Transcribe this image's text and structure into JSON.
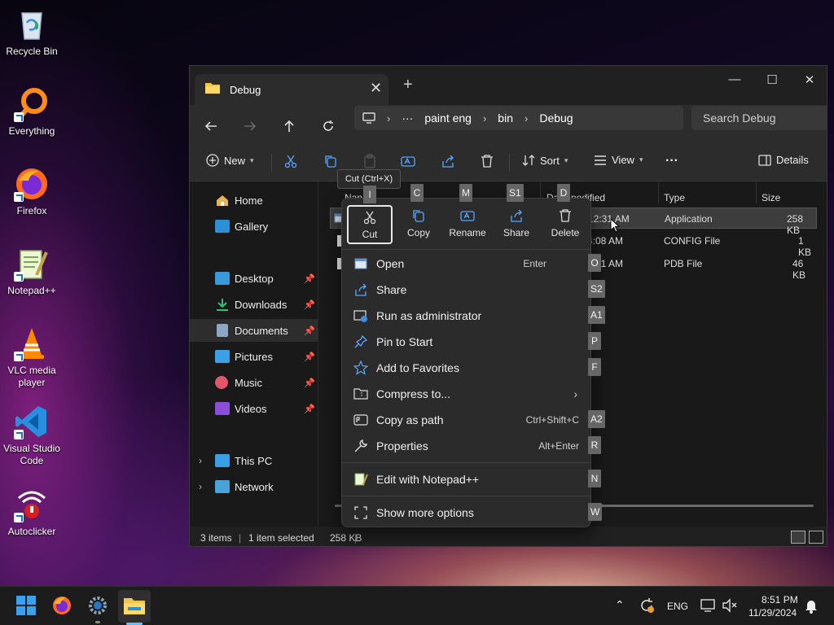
{
  "desktop_icons": [
    {
      "label": "Recycle Bin",
      "icon": "recycle-bin-icon"
    },
    {
      "label": "Everything",
      "icon": "everything-icon"
    },
    {
      "label": "Firefox",
      "icon": "firefox-icon"
    },
    {
      "label": "Notepad++",
      "icon": "notepad-plus-plus-icon"
    },
    {
      "label": "VLC media player",
      "icon": "vlc-icon"
    },
    {
      "label": "Visual Studio Code",
      "icon": "vscode-icon"
    },
    {
      "label": "Autoclicker",
      "icon": "autoclicker-icon"
    }
  ],
  "window": {
    "tab_title": "Debug",
    "tab_close": "✕",
    "new_tab": "+",
    "minimize": "—",
    "maximize": "☐",
    "close": "✕"
  },
  "address": {
    "more": "···",
    "crumbs": [
      "paint eng",
      "bin",
      "Debug"
    ],
    "search_placeholder": "Search Debug"
  },
  "toolbar": {
    "new_label": "New",
    "sort_label": "Sort",
    "view_label": "View",
    "more_label": "···",
    "details_label": "Details"
  },
  "sidebar": {
    "home": "Home",
    "gallery": "Gallery",
    "desktop": "Desktop",
    "downloads": "Downloads",
    "documents": "Documents",
    "pictures": "Pictures",
    "music": "Music",
    "videos": "Videos",
    "this_pc": "This PC",
    "network": "Network"
  },
  "columns": {
    "name": "Nan",
    "date": "Da",
    "date_tail": "nodified",
    "type": "Type",
    "size": "Size"
  },
  "rows": [
    {
      "date": "12:31 AM",
      "type": "Application",
      "size": "258 KB"
    },
    {
      "date": "4:08 AM",
      "type": "CONFIG File",
      "size": "1 KB"
    },
    {
      "date": "2:31 AM",
      "type": "PDB File",
      "size": "46 KB"
    }
  ],
  "status": {
    "items": "3 items",
    "selected": "1 item selected",
    "size": "258 KB",
    "divider": "|"
  },
  "tooltip": "Cut (Ctrl+X)",
  "context_menu": {
    "top_actions": {
      "cut": "Cut",
      "copy": "Copy",
      "rename": "Rename",
      "share": "Share",
      "delete": "Delete"
    },
    "items": {
      "open": {
        "label": "Open",
        "shortcut": "Enter"
      },
      "share": {
        "label": "Share"
      },
      "run_admin": {
        "label": "Run as administrator"
      },
      "pin_start": {
        "label": "Pin to Start"
      },
      "favorites": {
        "label": "Add to Favorites"
      },
      "compress": {
        "label": "Compress to...",
        "arrow": "›"
      },
      "copy_path": {
        "label": "Copy as path",
        "shortcut": "Ctrl+Shift+C"
      },
      "properties": {
        "label": "Properties",
        "shortcut": "Alt+Enter"
      },
      "notepad": {
        "label": "Edit with Notepad++"
      },
      "more_options": {
        "label": "Show more options"
      }
    }
  },
  "keytips": {
    "name_col": "I",
    "cut": "C",
    "rename": "M",
    "share": "S1",
    "delete": "D",
    "open": "O",
    "share_item": "S2",
    "run_admin": "A1",
    "pin": "P",
    "favorites": "F",
    "copy_path": "A2",
    "properties": "R",
    "notepad": "N",
    "more_options": "W"
  },
  "taskbar": {
    "language": "ENG",
    "time": "8:51 PM",
    "date": "11/29/2024"
  }
}
